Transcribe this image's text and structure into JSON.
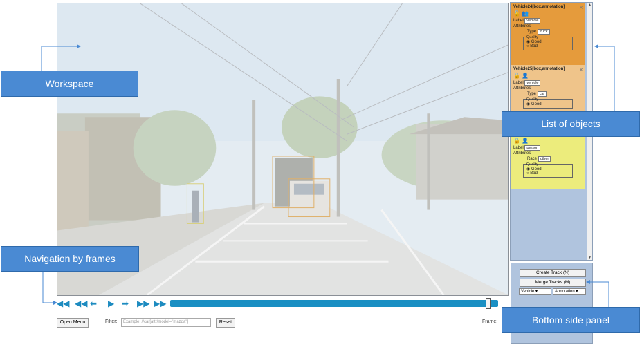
{
  "objects": [
    {
      "title": "Vehicle24[box,annotation]",
      "label_caption": "Label",
      "label_value": "vehicle",
      "attributes_caption": "Attributes",
      "attr_name": "Type",
      "attr_value": "truck",
      "quality_caption": "Quality",
      "options": [
        "Good",
        "Bad"
      ]
    },
    {
      "title": "Vehicle25[box,annotation]",
      "label_caption": "Label",
      "label_value": "vehicle",
      "attributes_caption": "Attributes",
      "attr_name": "Type",
      "attr_value": "car",
      "quality_caption": "Quality",
      "options": [
        "Good"
      ]
    },
    {
      "label_caption": "Label",
      "label_value": "person",
      "attributes_caption": "Attributes",
      "attr_name": "Race",
      "attr_value": "other",
      "quality_caption": "Quality",
      "options": [
        "Good",
        "Bad"
      ]
    }
  ],
  "bottom_panel": {
    "create_track": "Create Track (N)",
    "merge_tracks": "Merge Tracks (M)",
    "label_select": "Vehicle",
    "mode_select": "Annotation"
  },
  "bottom_bar": {
    "open_menu": "Open Menu",
    "filter_label": "Filter:",
    "filter_placeholder": "Example: //car[attr/model=\"mazda\"]",
    "reset": "Reset",
    "frame_label": "Frame:"
  },
  "callouts": {
    "workspace": "Workspace",
    "list_of_objects": "List of objects",
    "navigation": "Navigation by frames",
    "bottom_panel": "Bottom side panel"
  },
  "icons": {
    "close": "close-icon",
    "lock": "lock-icon",
    "person": "person-icon",
    "nav": [
      "first-frame-icon",
      "back-multi-icon",
      "prev-frame-icon",
      "back-step-icon",
      "play-icon",
      "next-frame-icon",
      "forward-multi-icon",
      "last-frame-icon"
    ]
  },
  "colors": {
    "accent": "#1a8fc3",
    "callout": "#4a8ad3",
    "sidebar": "#b0c4de",
    "obj1": "#e59b3c",
    "obj2": "#efc48a",
    "obj3": "#ecec7c"
  }
}
